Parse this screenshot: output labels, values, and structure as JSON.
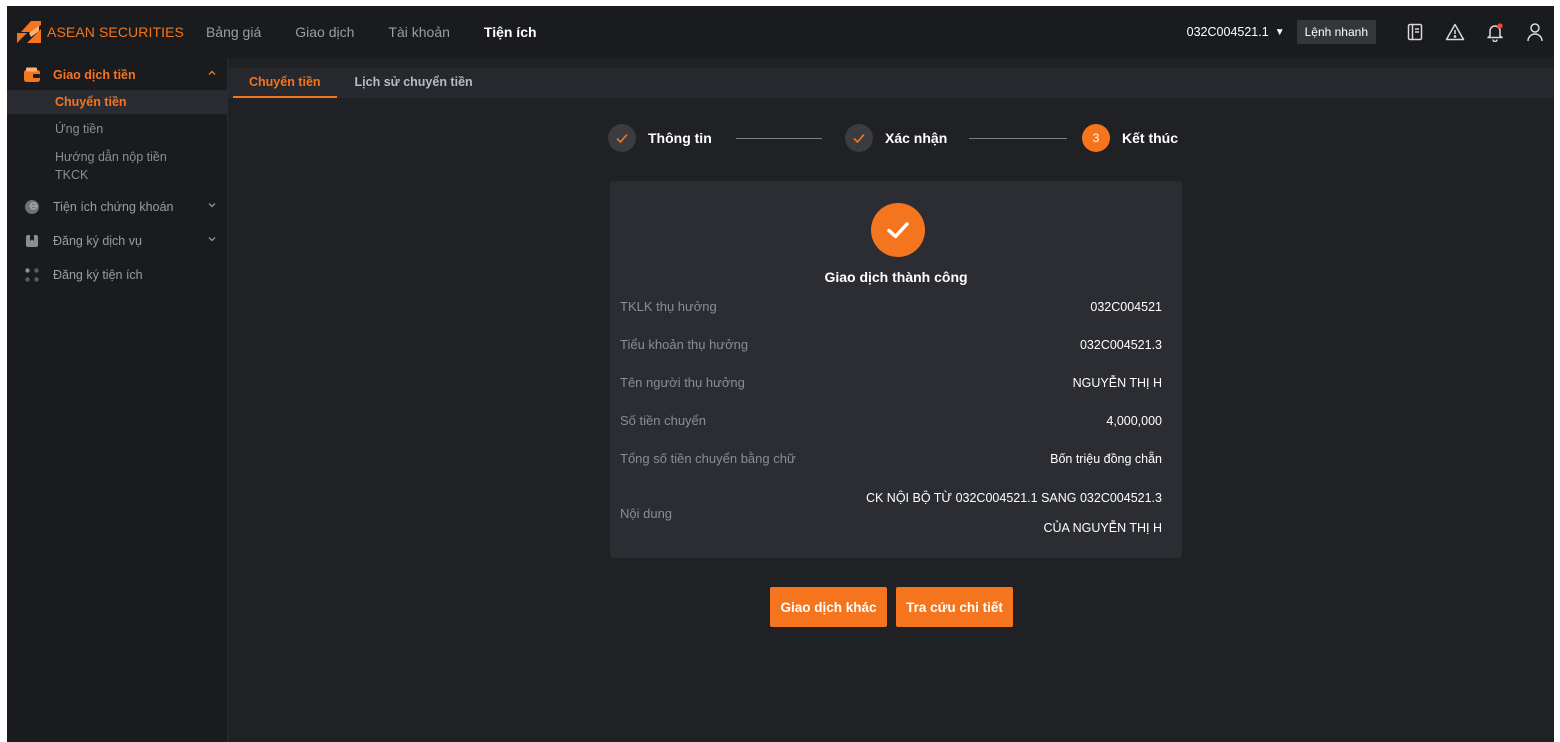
{
  "brand": {
    "name": "ASEAN SECURITIES",
    "accent": "#f5751f"
  },
  "nav": [
    {
      "label": "Bảng giá"
    },
    {
      "label": "Giao dịch"
    },
    {
      "label": "Tài khoản"
    },
    {
      "label": "Tiện ích"
    }
  ],
  "header": {
    "account": "032C004521.1",
    "quick_order": "Lệnh nhanh",
    "icons": [
      "book-icon",
      "alert-triangle-icon",
      "bell-icon",
      "user-icon"
    ]
  },
  "sidebar": {
    "groups": [
      {
        "label": "Giao dịch tiền",
        "icon": "wallet-icon",
        "open": true,
        "items": [
          {
            "label": "Chuyển tiền",
            "active": true
          },
          {
            "label": "Ứng tiền"
          },
          {
            "label": "Hướng dẫn nộp tiền TKCK"
          }
        ]
      },
      {
        "label": "Tiện ích chứng khoán",
        "icon": "coins-icon"
      },
      {
        "label": "Đăng ký dịch vụ",
        "icon": "bookmark-icon"
      },
      {
        "label": "Đăng ký tiện ích",
        "icon": "grid-dots-icon"
      }
    ]
  },
  "tabs": [
    {
      "label": "Chuyển tiền",
      "active": true
    },
    {
      "label": "Lịch sử chuyển tiền"
    }
  ],
  "steps": [
    {
      "label": "Thông tin",
      "status": "done"
    },
    {
      "label": "Xác nhận",
      "status": "done"
    },
    {
      "label": "Kết thúc",
      "number": "3",
      "status": "current"
    }
  ],
  "result": {
    "title": "Giao dịch thành công",
    "rows": [
      {
        "label": "TKLK thụ hưởng",
        "value": "032C004521"
      },
      {
        "label": "Tiểu khoản thụ hưởng",
        "value": "032C004521.3"
      },
      {
        "label": "Tên người thụ hưởng",
        "value": "NGUYỄN THỊ H"
      },
      {
        "label": "Số tiền chuyển",
        "value": "4,000,000"
      },
      {
        "label": "Tổng số tiền chuyển bằng chữ",
        "value": "Bốn triệu đồng chẵn"
      },
      {
        "label": "Nội dung",
        "value_line1": "CK NỘI BỘ TỪ 032C004521.1 SANG 032C004521.3",
        "value_line2": "CỦA NGUYỄN THỊ H"
      }
    ]
  },
  "actions": {
    "other_transaction": "Giao dịch khác",
    "view_detail": "Tra cứu chi tiết"
  }
}
